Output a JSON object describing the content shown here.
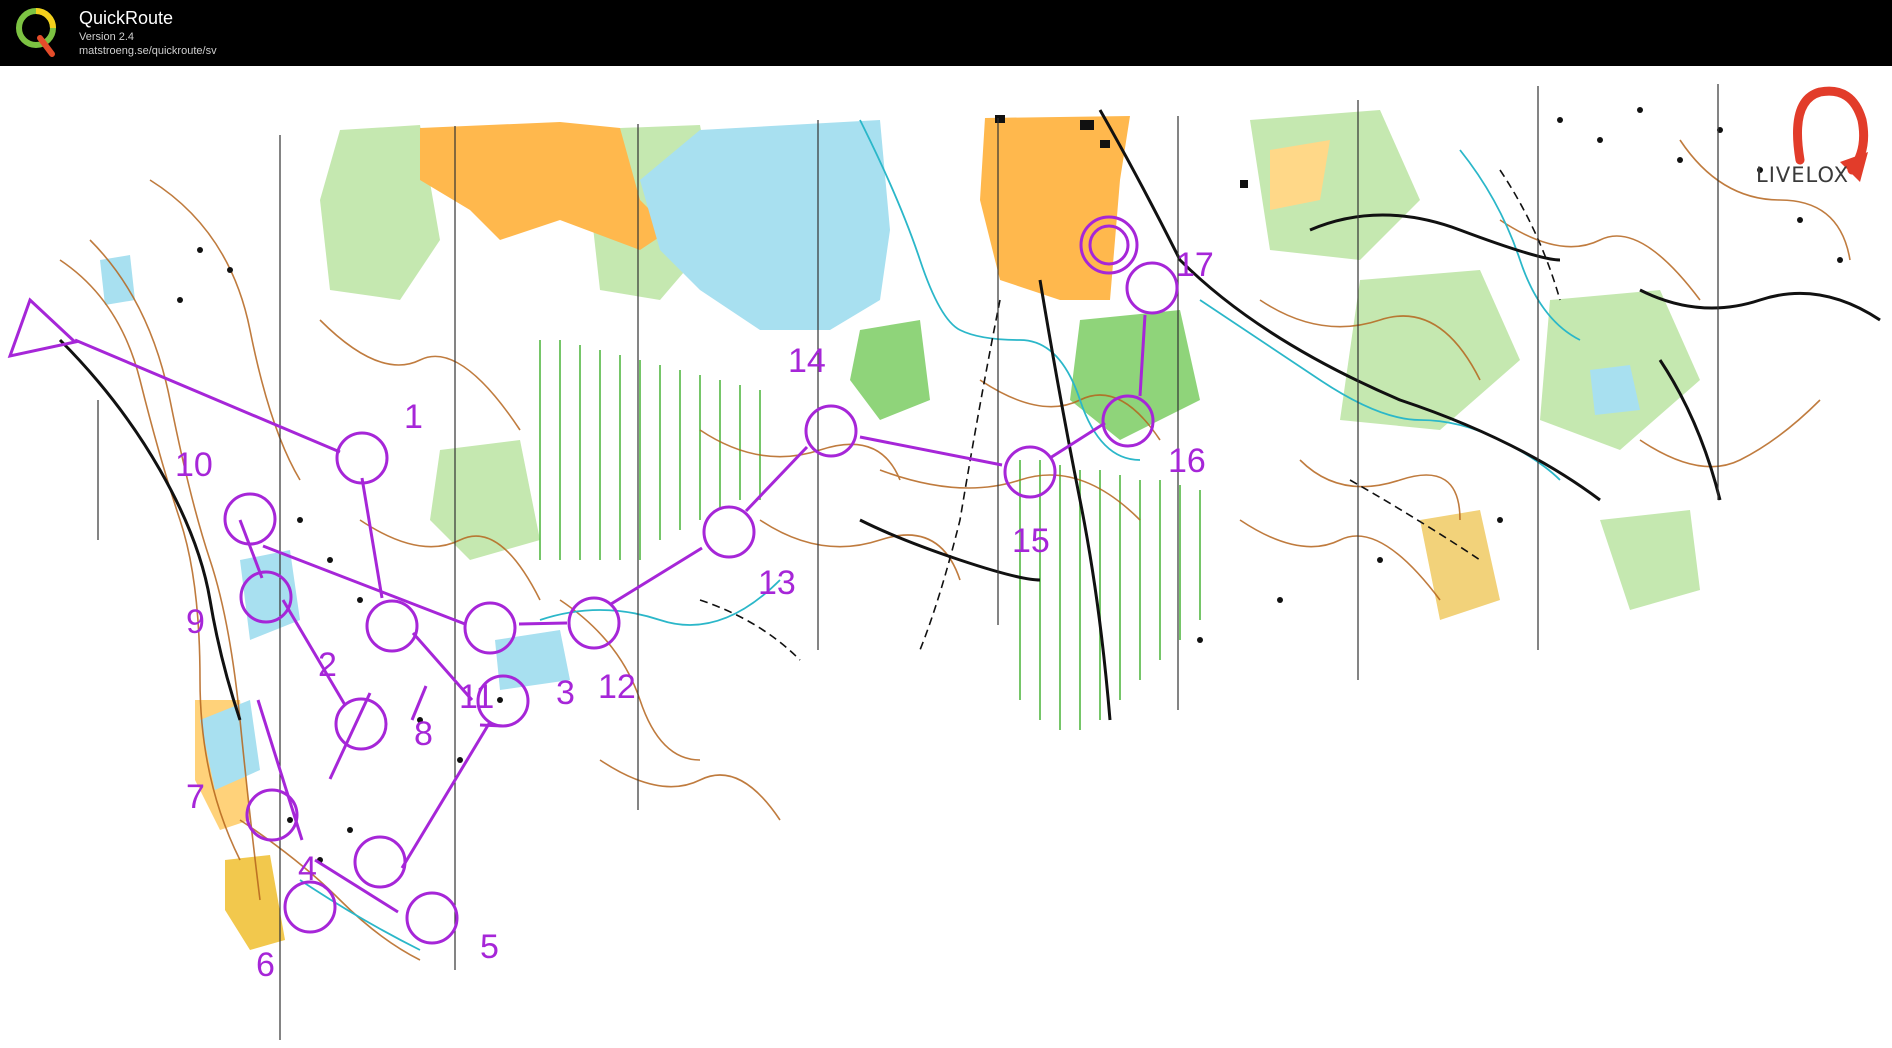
{
  "window": {
    "title": "QuickRoute",
    "version": "Version 2.4",
    "url": "matstroeng.se/quickroute/sv"
  },
  "logo_brand": "LIVELOX",
  "course": {
    "color": "#a626d8",
    "start": {
      "label": "start-triangle"
    },
    "finish": {
      "label": "finish-double-circle"
    },
    "controls": [
      {
        "number": "1"
      },
      {
        "number": "2"
      },
      {
        "number": "3"
      },
      {
        "number": "4"
      },
      {
        "number": "5"
      },
      {
        "number": "6"
      },
      {
        "number": "7"
      },
      {
        "number": "8"
      },
      {
        "number": "9"
      },
      {
        "number": "10"
      },
      {
        "number": "11"
      },
      {
        "number": "12"
      },
      {
        "number": "13"
      },
      {
        "number": "14"
      },
      {
        "number": "15"
      },
      {
        "number": "16"
      },
      {
        "number": "17"
      }
    ]
  },
  "map_colors": {
    "forest_white": "#ffffff",
    "green_light": "#c5e8b0",
    "green_medium": "#8fd47a",
    "yellow_open": "#ffb84d",
    "marsh_blue": "#a8e0f0",
    "contour_brown": "#b5651d",
    "road_black": "#111111",
    "stream_cyan": "#2bb7c9"
  }
}
